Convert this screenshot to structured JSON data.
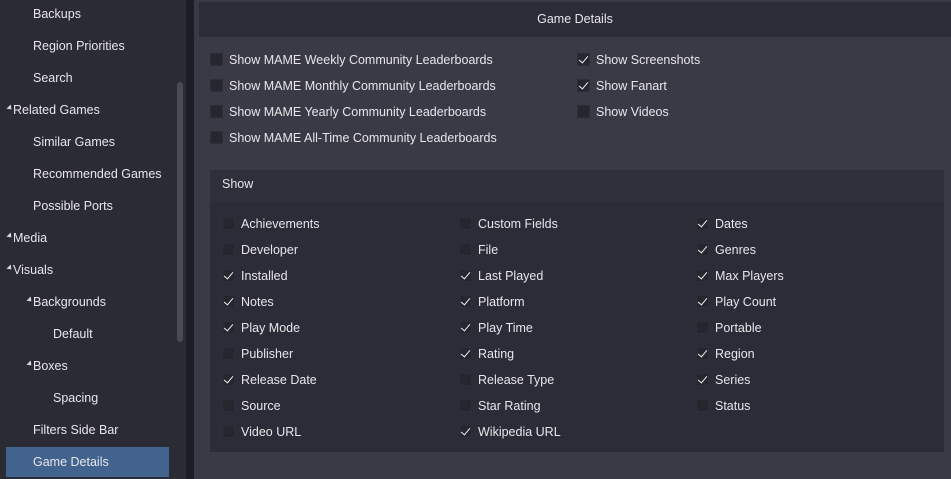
{
  "sidebar": {
    "items": [
      {
        "label": "Backups",
        "indent": 1
      },
      {
        "label": "Region Priorities",
        "indent": 1
      },
      {
        "label": "Search",
        "indent": 1
      },
      {
        "label": "Related Games",
        "indent": 0,
        "expanded": true
      },
      {
        "label": "Similar Games",
        "indent": 1
      },
      {
        "label": "Recommended Games",
        "indent": 1
      },
      {
        "label": "Possible Ports",
        "indent": 1
      },
      {
        "label": "Media",
        "indent": 0,
        "expanded": true
      },
      {
        "label": "Visuals",
        "indent": 0,
        "expanded": true
      },
      {
        "label": "Backgrounds",
        "indent": 1,
        "expanded": true
      },
      {
        "label": "Default",
        "indent": 2
      },
      {
        "label": "Boxes",
        "indent": 1,
        "expanded": true
      },
      {
        "label": "Spacing",
        "indent": 2
      },
      {
        "label": "Filters Side Bar",
        "indent": 1
      },
      {
        "label": "Game Details",
        "indent": 1,
        "selected": true
      }
    ]
  },
  "panel": {
    "title": "Game Details",
    "leaderboards": [
      {
        "label": "Show MAME Weekly Community Leaderboards",
        "checked": false
      },
      {
        "label": "Show MAME Monthly Community Leaderboards",
        "checked": false
      },
      {
        "label": "Show MAME Yearly Community Leaderboards",
        "checked": false
      },
      {
        "label": "Show MAME All-Time Community Leaderboards",
        "checked": false
      }
    ],
    "media": [
      {
        "label": "Show Screenshots",
        "checked": true
      },
      {
        "label": "Show Fanart",
        "checked": true
      },
      {
        "label": "Show Videos",
        "checked": false
      }
    ],
    "show_group": {
      "title": "Show",
      "columns": [
        [
          {
            "label": "Achievements",
            "checked": false
          },
          {
            "label": "Developer",
            "checked": false
          },
          {
            "label": "Installed",
            "checked": true
          },
          {
            "label": "Notes",
            "checked": true
          },
          {
            "label": "Play Mode",
            "checked": true
          },
          {
            "label": "Publisher",
            "checked": false
          },
          {
            "label": "Release Date",
            "checked": true
          },
          {
            "label": "Source",
            "checked": false
          },
          {
            "label": "Video URL",
            "checked": false
          }
        ],
        [
          {
            "label": "Custom Fields",
            "checked": false
          },
          {
            "label": "File",
            "checked": false
          },
          {
            "label": "Last Played",
            "checked": true
          },
          {
            "label": "Platform",
            "checked": true
          },
          {
            "label": "Play Time",
            "checked": true
          },
          {
            "label": "Rating",
            "checked": true
          },
          {
            "label": "Release Type",
            "checked": false
          },
          {
            "label": "Star Rating",
            "checked": false
          },
          {
            "label": "Wikipedia URL",
            "checked": true
          }
        ],
        [
          {
            "label": "Dates",
            "checked": true
          },
          {
            "label": "Genres",
            "checked": true
          },
          {
            "label": "Max Players",
            "checked": true
          },
          {
            "label": "Play Count",
            "checked": true
          },
          {
            "label": "Portable",
            "checked": false
          },
          {
            "label": "Region",
            "checked": true
          },
          {
            "label": "Series",
            "checked": true
          },
          {
            "label": "Status",
            "checked": false
          }
        ]
      ]
    }
  },
  "colors": {
    "background": "#2b2b36",
    "panel": "#3a3a47",
    "selected": "#43638f",
    "checkbox": "#26262f"
  }
}
